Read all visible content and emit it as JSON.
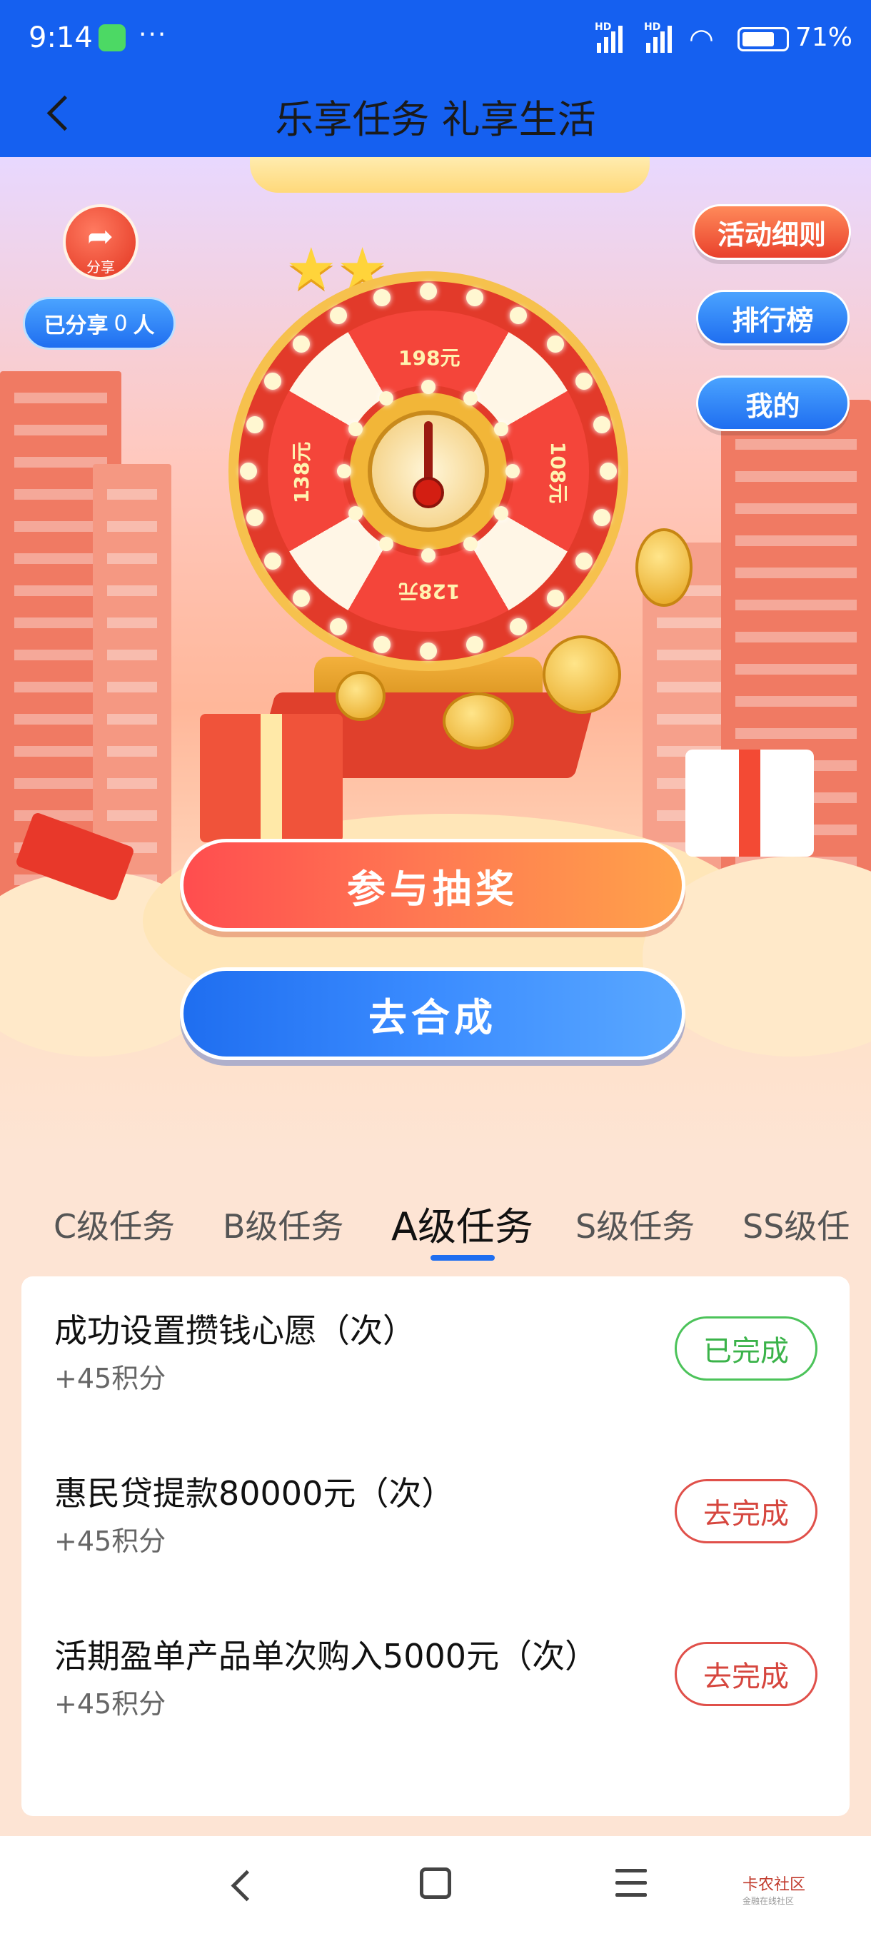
{
  "status_bar": {
    "time": "9:14",
    "dots": "···",
    "hd1": "HD",
    "hd2": "HD",
    "battery": "71%"
  },
  "header": {
    "title": "乐享任务 礼享生活"
  },
  "hero": {
    "share_label": "分享",
    "shared_prefix": "已分享",
    "shared_count": "0",
    "shared_suffix": "人",
    "rules_label": "活动细则",
    "rank_label": "排行榜",
    "mine_label": "我的",
    "wheel_prizes": [
      "198元",
      "108元",
      "128元",
      "138元"
    ],
    "draw_button": "参与抽奖",
    "merge_button": "去合成"
  },
  "tabs": [
    {
      "label": "C级任务"
    },
    {
      "label": "B级任务"
    },
    {
      "label": "A级任务"
    },
    {
      "label": "S级任务"
    },
    {
      "label": "SS级任"
    }
  ],
  "active_tab": "A级任务",
  "tasks": [
    {
      "title": "成功设置攒钱心愿（次）",
      "points": "+45积分",
      "action": "已完成",
      "status": "done"
    },
    {
      "title": "惠民贷提款80000元（次）",
      "points": "+45积分",
      "action": "去完成",
      "status": "todo"
    },
    {
      "title": "活期盈单产品单次购入5000元（次）",
      "points": "+45积分",
      "action": "去完成",
      "status": "todo"
    }
  ],
  "watermark": {
    "title": "卡农社区",
    "sub": "金融在线社区"
  },
  "colors": {
    "primary_blue": "#1560f0",
    "done_green": "#3bb34a",
    "todo_red": "#d6463e"
  }
}
